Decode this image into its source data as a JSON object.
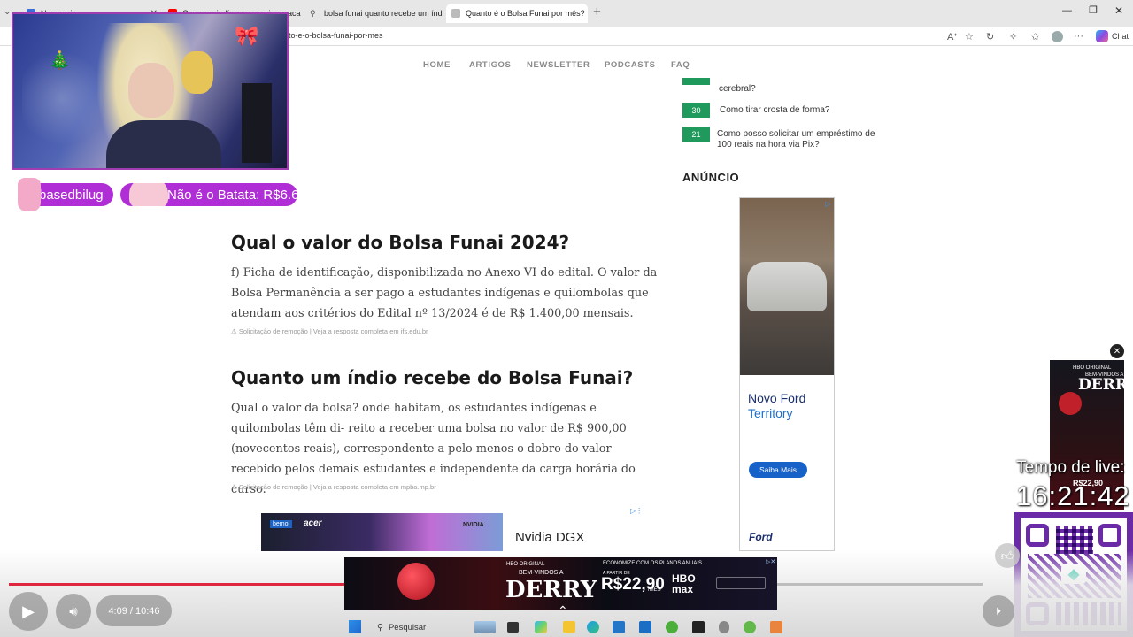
{
  "browser": {
    "tabs": [
      {
        "label": "Nova guia",
        "favicon_color": "#3a6fd8"
      },
      {
        "label": "Como os indígenas precisam aca",
        "favicon_color": "#ff0000"
      },
      {
        "label": "bolsa funai quanto recebe um índi",
        "favicon_color": "#666666"
      },
      {
        "label": "Quanto é o Bolsa Funai por mês?",
        "favicon_color": "#999999"
      }
    ],
    "url": "to-e-o-bolsa-funai-por-mes",
    "chat_label": "Chat"
  },
  "site": {
    "nav": [
      "HOME",
      "ARTIGOS",
      "NEWSLETTER",
      "PODCASTS",
      "FAQ"
    ],
    "ranking": [
      {
        "num": "",
        "text": "cerebral?"
      },
      {
        "num": "30",
        "text": "Como tirar crosta de forma?"
      },
      {
        "num": "21",
        "text": "Como posso solicitar um empréstimo de 100 reais na hora via Pix?"
      }
    ],
    "ad_label": "ANÚNCIO",
    "ford_ad": {
      "line1": "Novo Ford",
      "line2": "Territory",
      "cta": "Saiba Mais",
      "logo": "Ford"
    },
    "sections": [
      {
        "title": "Qual o valor do Bolsa Funai 2024?",
        "body": "f) Ficha de identificação, disponibilizada no Anexo VI do edital. O valor da Bolsa Permanência a ser pago a estudantes indígenas e quilombolas que atendam aos critérios do Edital nº 13/2024 é de R$ 1.400,00 mensais.",
        "source": "Solicitação de remoção  |  Veja a resposta completa em ifs.edu.br"
      },
      {
        "title": "Quanto um índio recebe do Bolsa Funai?",
        "body": "Qual o valor da bolsa? onde habitam, os estudantes indígenas e quilombolas têm di- reito a receber uma bolsa no valor de R$ 900,00 (novecentos reais), correspondente a pelo menos o dobro do valor recebido pelos demais estudantes e independente da carga horária do curso.",
        "source": "Solicitação de remoção  |  Veja a resposta completa em mpba.mp.br"
      }
    ],
    "inline_ad": {
      "brand1": "bemol",
      "brand2": "acer",
      "brand3": "NVIDIA",
      "title": "Nvidia DGX"
    }
  },
  "stream": {
    "badge1": "basedbilug",
    "badge2": "Não é o Batata: R$6.6",
    "live_label": "Tempo de live:",
    "live_time": "16:21:42"
  },
  "player": {
    "time": "4:09 / 10:46",
    "progress_fraction": 0.389
  },
  "hbo_ad": {
    "small": "HBO ORIGINAL",
    "tag": "BEM-VINDOS A",
    "title": "DERRY",
    "promo": "ECONOMIZE COM OS PLANOS ANUAIS",
    "from": "A PARTIR DE",
    "price": "R$22,90",
    "per": "/MÊS",
    "brand": "HBO max"
  },
  "taskbar": {
    "search": "Pesquisar"
  },
  "colors": {
    "accent_green": "#1f9a5c",
    "stream_purple": "#a13db0",
    "progress_red": "#e0263f"
  }
}
